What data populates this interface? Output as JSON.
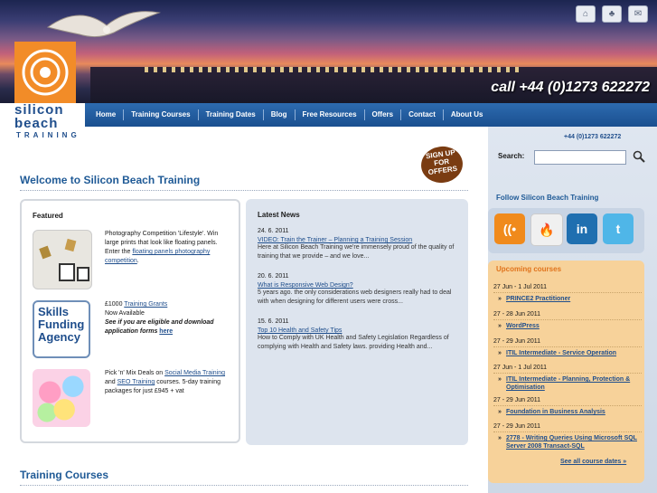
{
  "header": {
    "phone_banner": "call +44 (0)1273 622272",
    "top_icons": [
      "home-icon",
      "sitemap-icon",
      "contact-icon"
    ]
  },
  "logo": {
    "line1": "silicon",
    "line2": "beach",
    "line3": "TRAINING"
  },
  "nav": {
    "items": [
      "Home",
      "Training Courses",
      "Training Dates",
      "Blog",
      "Free Resources",
      "Offers",
      "Contact",
      "About Us"
    ]
  },
  "main": {
    "welcome_title": "Welcome to Silicon Beach Training",
    "signup_badge": "SIGN UP FOR OFFERS",
    "featured": {
      "title": "Featured",
      "items": [
        {
          "text1": "Photography Competition 'Lifestyle'. Win large prints that look like floating panels. Enter the ",
          "link": "floating panels photography competition",
          "text2": "."
        },
        {
          "thumb_lines": [
            "Skills",
            "Funding",
            "Agency"
          ],
          "prefix": "£1000 ",
          "link": "Training Grants",
          "line2": "Now Available",
          "line3": "See if you are eligible and download application forms ",
          "link2": "here"
        },
        {
          "prefix": "Pick 'n' Mix Deals on ",
          "link": "Social Media Training",
          "middle": " and ",
          "link2": "SEO Training",
          "suffix": " courses. 5-day training packages for just £945 + vat"
        }
      ]
    },
    "news": {
      "title": "Latest News",
      "items": [
        {
          "date": "24. 6. 2011",
          "link": "VIDEO: Train the Trainer – Planning a Training Session",
          "text": "Here at Silicon Beach Training we're immensely proud of the quality of training that we provide – and we love..."
        },
        {
          "date": "20. 6. 2011",
          "link": "What is Responsive Web Design?",
          "text": "5 years ago. the only considerations web designers really had to deal with when designing for different users were cross..."
        },
        {
          "date": "15. 6. 2011",
          "link": "Top 10 Health and Safety Tips",
          "text": "How to Comply with UK Health and Safety Legislation Regardless of complying with Health and Safety laws. providing Health and..."
        }
      ]
    },
    "training_courses_title": "Training Courses"
  },
  "sidebar": {
    "phone": "+44 (0)1273 622272",
    "search_label": "Search:",
    "search_value": "",
    "follow_title": "Follow Silicon Beach Training",
    "social": [
      "rss-icon",
      "feedburner-icon",
      "linkedin-icon",
      "twitter-icon"
    ],
    "social_glyphs": [
      "((•",
      "🔥",
      "in",
      "t"
    ],
    "upcoming_title": "Upcoming courses",
    "courses": [
      {
        "date": "27 Jun - 1 Jul 2011",
        "name": "PRINCE2 Practitioner"
      },
      {
        "date": "27 - 28 Jun 2011",
        "name": "WordPress"
      },
      {
        "date": "27 - 29 Jun 2011",
        "name": "ITIL Intermediate - Service Operation"
      },
      {
        "date": "27 Jun - 1 Jul 2011",
        "name": "ITIL Intermediate - Planning, Protection & Optimisation"
      },
      {
        "date": "27 - 29 Jun 2011",
        "name": "Foundation in Business Analysis"
      },
      {
        "date": "27 - 29 Jun 2011",
        "name": "2778 - Writing Queries Using Microsoft SQL Server 2008 Transact-SQL"
      }
    ],
    "see_all": "See all course dates »"
  },
  "colors": {
    "brand_blue": "#1f5a96",
    "nav_blue": "#1a4f8f",
    "accent_orange": "#f28c28"
  }
}
